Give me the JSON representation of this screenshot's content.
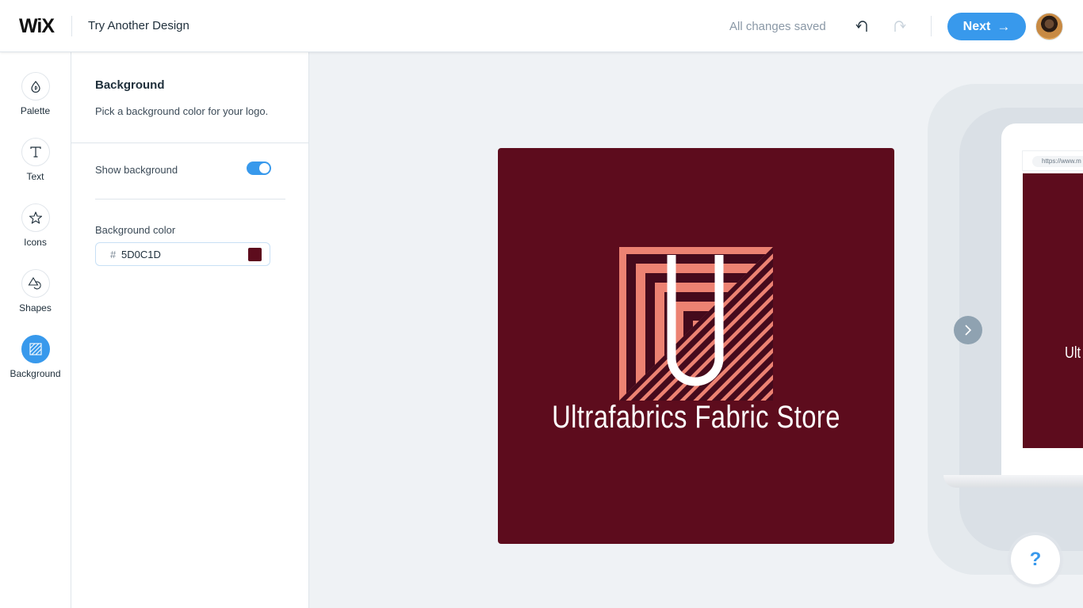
{
  "header": {
    "brand": "WiX",
    "title": "Try Another Design",
    "save_status": "All changes saved",
    "undo_icon": "undo-icon",
    "redo_icon": "redo-icon",
    "next_label": "Next",
    "next_arrow": "→",
    "avatar_icon": "user-avatar"
  },
  "sidebar": {
    "items": [
      {
        "label": "Palette",
        "icon": "palette-drop-icon",
        "active": false
      },
      {
        "label": "Text",
        "icon": "text-T-icon",
        "active": false
      },
      {
        "label": "Icons",
        "icon": "star-icon",
        "active": false
      },
      {
        "label": "Shapes",
        "icon": "shapes-icon",
        "active": false
      },
      {
        "label": "Background",
        "icon": "background-hatch-icon",
        "active": true
      }
    ]
  },
  "panel": {
    "title": "Background",
    "description": "Pick a background color for your logo.",
    "show_background_label": "Show background",
    "show_background_on": true,
    "background_color_label": "Background color",
    "hash": "#",
    "background_color_value": "5D0C1D"
  },
  "canvas": {
    "logo_text": "Ultrafabrics Fabric Store",
    "logo_letter": "U",
    "mockup_url": "https://www.m",
    "mockup_text": "Ult",
    "help_label": "?"
  },
  "colors": {
    "accent": "#3899EC",
    "logo_background": "#5D0C1D",
    "logo_stripe": "#EC8272",
    "logo_stripe_dark": "#450A1C",
    "logo_text": "#FFFFFF"
  }
}
